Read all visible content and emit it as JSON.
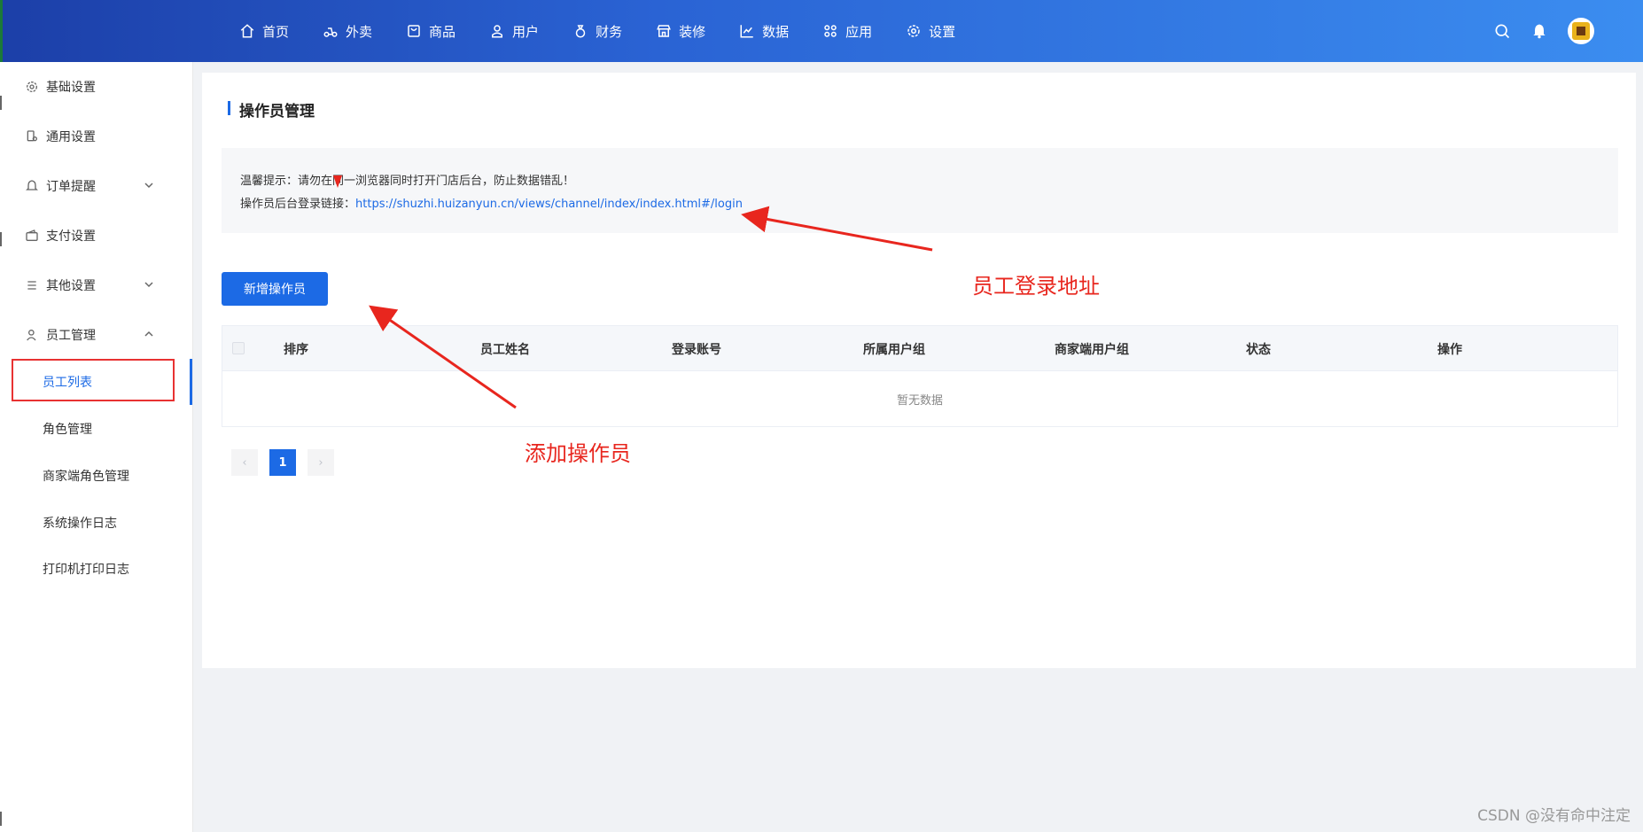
{
  "nav": {
    "items": [
      {
        "label": "首页",
        "icon": "home-icon"
      },
      {
        "label": "外卖",
        "icon": "scooter-icon"
      },
      {
        "label": "商品",
        "icon": "bag-icon"
      },
      {
        "label": "用户",
        "icon": "user-icon"
      },
      {
        "label": "财务",
        "icon": "money-bag-icon"
      },
      {
        "label": "装修",
        "icon": "shop-icon"
      },
      {
        "label": "数据",
        "icon": "line-chart-icon"
      },
      {
        "label": "应用",
        "icon": "apps-icon"
      },
      {
        "label": "设置",
        "icon": "gear-icon"
      }
    ]
  },
  "sidebar": {
    "items": [
      {
        "label": "基础设置",
        "icon": "gear-icon"
      },
      {
        "label": "通用设置",
        "icon": "device-icon"
      },
      {
        "label": "订单提醒",
        "icon": "bell-icon",
        "chevron": "down"
      },
      {
        "label": "支付设置",
        "icon": "wallet-icon"
      },
      {
        "label": "其他设置",
        "icon": "list-icon",
        "chevron": "down"
      },
      {
        "label": "员工管理",
        "icon": "user-icon",
        "chevron": "up"
      }
    ],
    "sub_items": [
      {
        "label": "员工列表",
        "active": true
      },
      {
        "label": "角色管理"
      },
      {
        "label": "商家端角色管理"
      },
      {
        "label": "系统操作日志"
      },
      {
        "label": "打印机打印日志"
      }
    ]
  },
  "main": {
    "title": "操作员管理",
    "tip_line1": "温馨提示：请勿在同一浏览器同时打开门店后台，防止数据错乱！",
    "tip_line2_prefix": "操作员后台登录链接：",
    "tip_line2_link": "https://shuzhi.huizanyun.cn/views/channel/index/index.html#/login",
    "add_button": "新增操作员",
    "table": {
      "columns": [
        "排序",
        "员工姓名",
        "登录账号",
        "所属用户组",
        "商家端用户组",
        "状态",
        "操作"
      ],
      "empty_text": "暂无数据"
    },
    "pagination": {
      "current": "1",
      "prev": "‹",
      "next": "›"
    }
  },
  "annotations": {
    "login_address": "员工登录地址",
    "add_operator": "添加操作员"
  },
  "watermark": "CSDN @没有命中注定",
  "colors": {
    "primary": "#1c6ae5",
    "annotation": "#e8261e"
  }
}
